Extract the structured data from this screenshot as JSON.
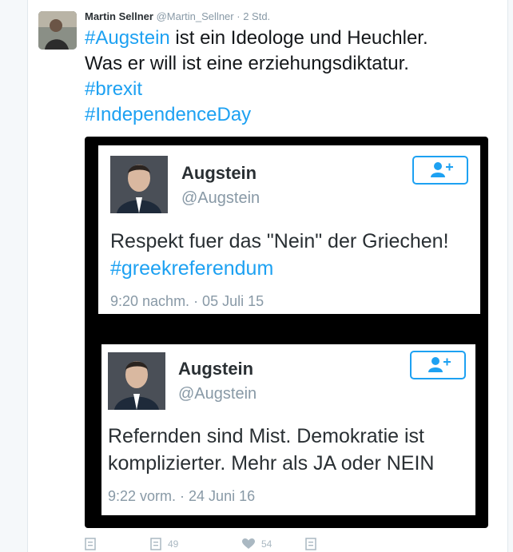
{
  "tweet": {
    "author_name": "Martin Sellner",
    "author_handle": "@Martin_Sellner",
    "separator": "·",
    "time": "2 Std.",
    "text_parts": {
      "tag1": "#Augstein",
      "line1_rest": " ist ein Ideologe und Heuchler.",
      "line2": "Was er will ist eine erziehungsdiktatur.",
      "tag2": "#brexit",
      "tag3": "#IndependenceDay"
    }
  },
  "embedded": [
    {
      "name": "Augstein",
      "handle": "@Augstein",
      "text": "Respekt fuer das \"Nein\" der Griechen!",
      "hashtag": "#greekreferendum",
      "time": "9:20 nachm. · 05 Juli 15"
    },
    {
      "name": "Augstein",
      "handle": "@Augstein",
      "text": "Refernden sind Mist. Demokratie ist komplizierter. Mehr als JA oder NEIN",
      "time": "9:22 vorm. · 24 Juni 16"
    }
  ],
  "actions": {
    "reply_icon": "reply-icon",
    "retweet_icon": "retweet-icon",
    "retweet_count": "49",
    "like_icon": "heart-icon",
    "like_count": "54",
    "more_icon": "more-icon"
  },
  "colors": {
    "accent": "#1da1f2",
    "muted": "#8899a6",
    "media_bg": "#000000"
  }
}
